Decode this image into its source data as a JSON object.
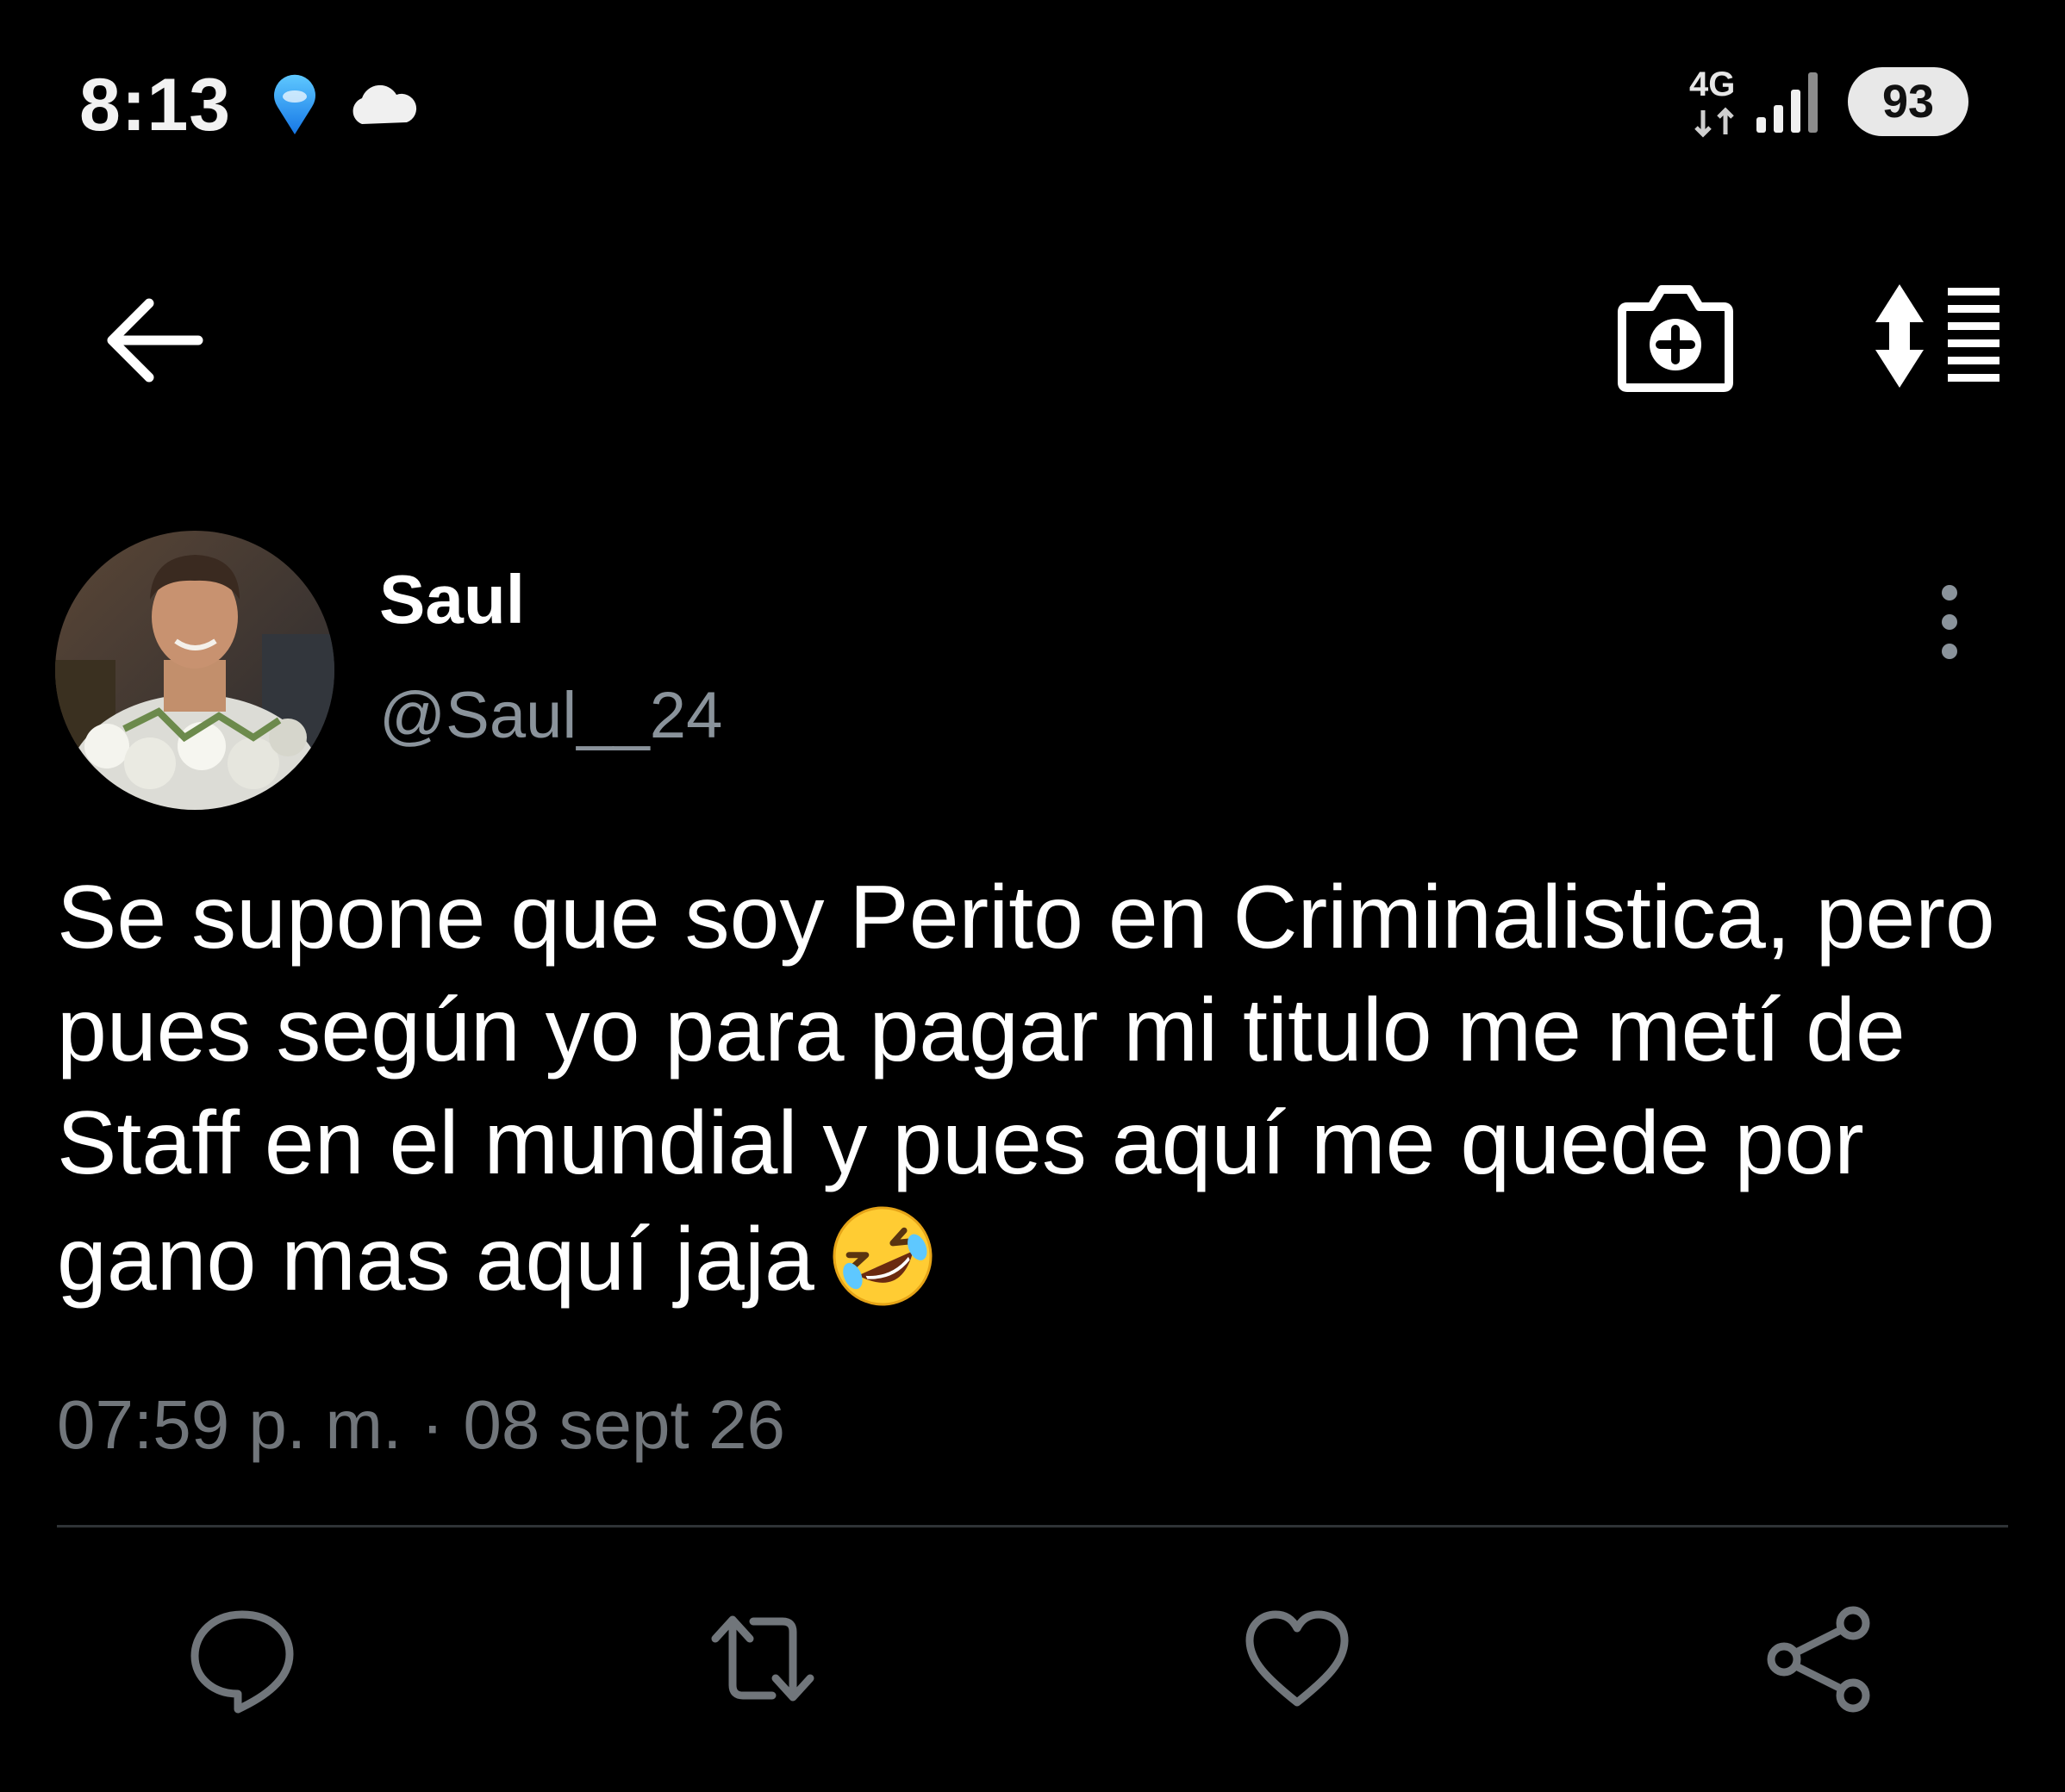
{
  "status_bar": {
    "time": "8:13",
    "network_label": "4G",
    "battery_level": "93",
    "icons": [
      "location-pin-icon",
      "cloud-icon",
      "signal-icon"
    ]
  },
  "header": {
    "icons": [
      "back-arrow-icon",
      "camera-add-icon",
      "sort-icon"
    ]
  },
  "tweet": {
    "author_name": "Saul",
    "author_handle": "@Saul__24",
    "text": "Se supone que soy Perito en Criminalistica, pero pues según yo para pagar mi titulo me metí de Staff en el mundial y pues aquí me quede por gano mas aquí jaja",
    "emoji": "rolling-on-floor-laughing-emoji",
    "timestamp": "07:59 p. m. · 08 sept 26",
    "actions": [
      "reply-icon",
      "retweet-icon",
      "like-icon",
      "share-icon"
    ]
  },
  "colors": {
    "background": "#000000",
    "text_primary": "#ffffff",
    "text_secondary": "#71767b",
    "divider": "#2f3336"
  }
}
